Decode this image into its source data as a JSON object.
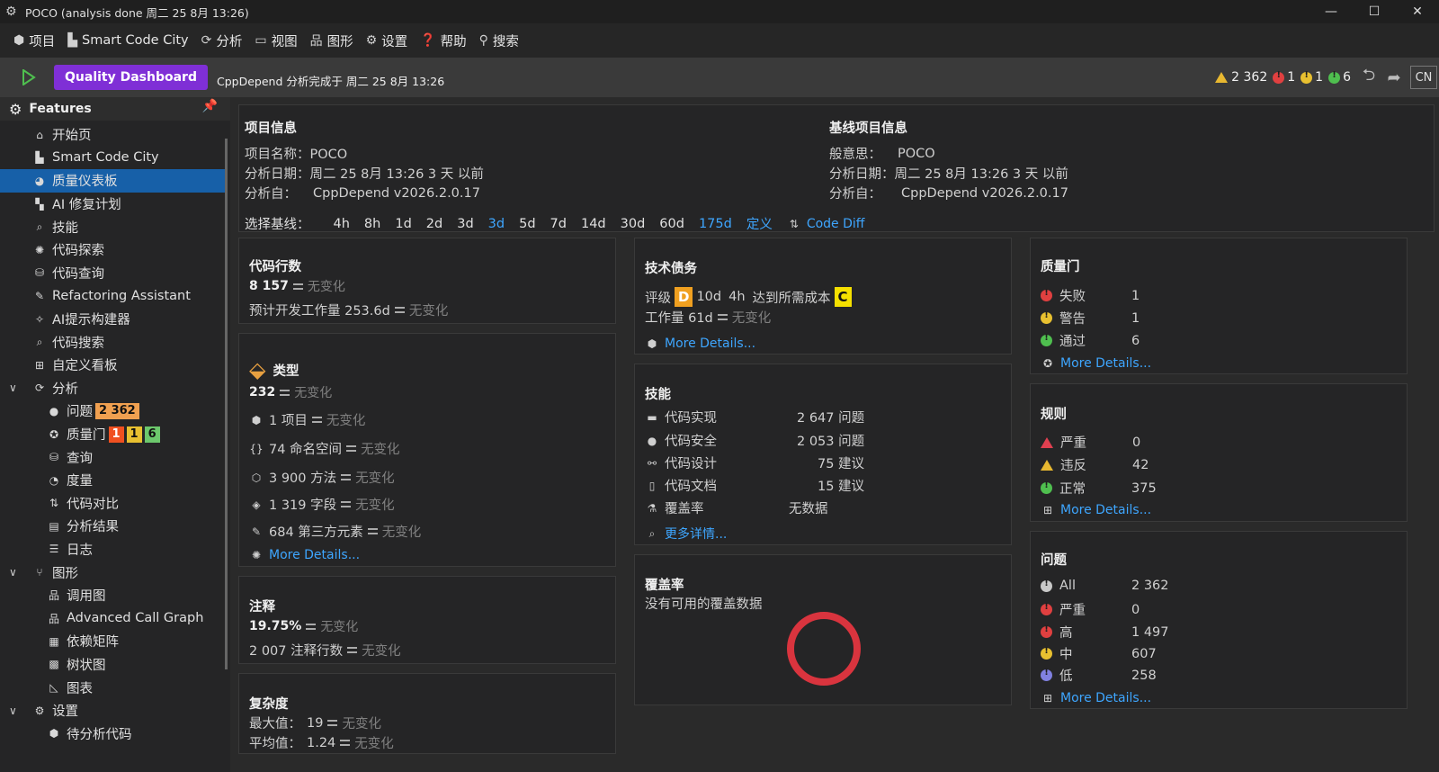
{
  "window": {
    "title": "POCO (analysis done 周二 25 8月  13:26)"
  },
  "menu": [
    {
      "icon": "cube-icon",
      "label": "项目"
    },
    {
      "icon": "city-icon",
      "label": "Smart Code City"
    },
    {
      "icon": "analyze-icon",
      "label": "分析"
    },
    {
      "icon": "view-icon",
      "label": "视图"
    },
    {
      "icon": "graph-icon",
      "label": "图形"
    },
    {
      "icon": "gear-icon",
      "label": "设置"
    },
    {
      "icon": "help-icon",
      "label": "帮助"
    },
    {
      "icon": "search-icon",
      "label": "搜索"
    }
  ],
  "toolbar": {
    "dashboard_button": "Quality Dashboard",
    "status_text": "CppDepend 分析完成于 周二 25 8月  13:26",
    "warn_count": "2 362",
    "fail_count": "1",
    "warn_gate_count": "1",
    "pass_count": "6",
    "lang_button": "CN"
  },
  "sidebar": {
    "header": "Features",
    "items": [
      {
        "label": "开始页",
        "icon": "home-icon"
      },
      {
        "label": "Smart Code City",
        "icon": "city-icon"
      },
      {
        "label": "质量仪表板",
        "icon": "dashboard-icon"
      },
      {
        "label": "AI 修复计划",
        "icon": "ai-plan-icon"
      },
      {
        "label": "技能",
        "icon": "skill-icon"
      },
      {
        "label": "代码探索",
        "icon": "explore-icon"
      },
      {
        "label": "代码查询",
        "icon": "query-icon"
      },
      {
        "label": "Refactoring Assistant",
        "icon": "refactor-icon"
      },
      {
        "label": "AI提示构建器",
        "icon": "ai-prompt-icon"
      },
      {
        "label": "代码搜索",
        "icon": "code-search-icon"
      },
      {
        "label": "自定义看板",
        "icon": "board-icon"
      }
    ],
    "analysis_group": "分析",
    "analysis_items": [
      {
        "label": "问题",
        "icon": "issue-icon"
      },
      {
        "label": "质量门",
        "icon": "gate-icon"
      },
      {
        "label": "查询",
        "icon": "query-icon"
      },
      {
        "label": "度量",
        "icon": "metric-icon"
      },
      {
        "label": "代码对比",
        "icon": "diff-icon"
      },
      {
        "label": "分析结果",
        "icon": "result-icon"
      },
      {
        "label": "日志",
        "icon": "log-icon"
      }
    ],
    "issues_badge": "2 362",
    "gate_badges": [
      "1",
      "1",
      "6"
    ],
    "graph_group": "图形",
    "graph_items": [
      {
        "label": "调用图",
        "icon": "callgraph-icon"
      },
      {
        "label": "Advanced Call Graph",
        "icon": "adv-callgraph-icon"
      },
      {
        "label": "依赖矩阵",
        "icon": "matrix-icon"
      },
      {
        "label": "树状图",
        "icon": "treemap-icon"
      },
      {
        "label": "图表",
        "icon": "chart-icon"
      }
    ],
    "settings_group": "设置",
    "settings_items": [
      {
        "label": "待分析代码",
        "icon": "code-icon"
      }
    ]
  },
  "project_info": {
    "title": "项目信息",
    "name": "项目名称：POCO",
    "date": "分析日期：周二 25 8月  13:26 3 天 以前",
    "by_label": "分析自：",
    "by_value": "CppDepend v2026.2.0.17",
    "baseline_title": "基线项目信息",
    "baseline_label": "般意思：",
    "baseline_name": "POCO",
    "baseline_date": "分析日期：周二 25 8月  13:26 3 天 以前",
    "baseline_by_label": "分析自：",
    "baseline_by_value": "CppDepend v2026.2.0.17",
    "select_baseline": "选择基线：",
    "baseline_options": [
      "4h",
      "8h",
      "1d",
      "2d",
      "3d",
      "3d",
      "5d",
      "7d",
      "14d",
      "30d",
      "60d",
      "175d",
      "定义"
    ],
    "code_diff": "Code Diff"
  },
  "loc": {
    "title": "代码行数",
    "value": "8 157",
    "value_change": "无变化",
    "effort": "预计开发工作量 253.6d",
    "effort_change": "无变化"
  },
  "types": {
    "title": "类型",
    "value": "232",
    "value_change": "无变化",
    "rows": [
      {
        "icon": "cube-icon",
        "text": "1 项目",
        "change": "无变化"
      },
      {
        "icon": "braces-icon",
        "text": "74 命名空间",
        "change": "无变化"
      },
      {
        "icon": "method-icon",
        "text": "3 900 方法",
        "change": "无变化"
      },
      {
        "icon": "field-icon",
        "text": "1 319 字段",
        "change": "无变化"
      },
      {
        "icon": "thirdparty-icon",
        "text": "684 第三方元素",
        "change": "无变化"
      }
    ],
    "more": "More Details..."
  },
  "comments": {
    "title": "注释",
    "value": "19.75%",
    "value_change": "无变化",
    "lines": "2 007 注释行数",
    "lines_change": "无变化"
  },
  "complexity": {
    "title": "复杂度",
    "max_label": "最大值：",
    "max_value": "19",
    "max_change": "无变化",
    "avg_label": "平均值：",
    "avg_value": "1.24",
    "avg_change": "无变化"
  },
  "debt": {
    "title": "技术债务",
    "rating_label": "评级",
    "rating": "D",
    "time1": "10d",
    "time2": "4h",
    "reach": "达到所需成本",
    "target": "C",
    "effort": "工作量 61d",
    "effort_change": "无变化",
    "more": "More Details..."
  },
  "skills": {
    "title": "技能",
    "rows": [
      {
        "icon": "impl-icon",
        "label": "代码实现",
        "value": "2 647 问题"
      },
      {
        "icon": "security-icon",
        "label": "代码安全",
        "value": "2 053 问题"
      },
      {
        "icon": "design-icon",
        "label": "代码设计",
        "value": "75 建议"
      },
      {
        "icon": "doc-icon",
        "label": "代码文档",
        "value": "15 建议"
      },
      {
        "icon": "coverage-icon",
        "label": "覆盖率",
        "value": "无数据"
      }
    ],
    "more": "更多详情..."
  },
  "coverage": {
    "title": "覆盖率",
    "text": "没有可用的覆盖数据",
    "ring_color": "#d9343e"
  },
  "quality_gate": {
    "title": "质量门",
    "rows": [
      {
        "label": "失败",
        "value": "1",
        "color": "#e04040"
      },
      {
        "label": "警告",
        "value": "1",
        "color": "#e8c030"
      },
      {
        "label": "通过",
        "value": "6",
        "color": "#4fbf4f"
      }
    ],
    "more": "More Details..."
  },
  "rules": {
    "title": "规则",
    "rows": [
      {
        "label": "严重",
        "value": "0",
        "color": "#e04050"
      },
      {
        "label": "违反",
        "value": "42",
        "color": "#e8c030"
      },
      {
        "label": "正常",
        "value": "375",
        "color": "#4fbf4f"
      }
    ],
    "more": "More Details..."
  },
  "issues": {
    "title": "问题",
    "rows": [
      {
        "label": "All",
        "value": "2 362",
        "color": "#c8c8c8"
      },
      {
        "label": "严重",
        "value": "0",
        "color": "#e04040"
      },
      {
        "label": "高",
        "value": "1 497",
        "color": "#e04040"
      },
      {
        "label": "中",
        "value": "607",
        "color": "#e8c030"
      },
      {
        "label": "低",
        "value": "258",
        "color": "#8080e0"
      }
    ],
    "more": "More Details..."
  }
}
